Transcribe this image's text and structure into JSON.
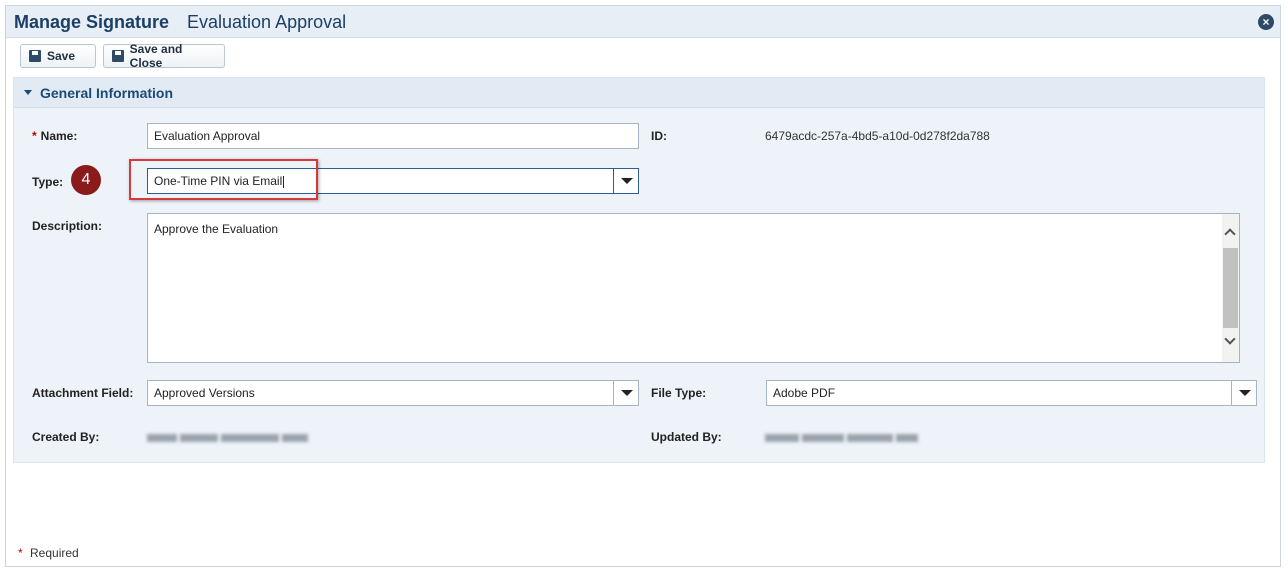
{
  "window": {
    "title": "Manage Signature",
    "subtitle": "Evaluation Approval",
    "close_icon": "close-circle-icon"
  },
  "toolbar": {
    "save_label": "Save",
    "save_close_label": "Save and Close"
  },
  "section": {
    "title": "General Information"
  },
  "form": {
    "required_marker": "*",
    "name_label": "Name:",
    "name_value": "Evaluation Approval",
    "id_label": "ID:",
    "id_value": "6479acdc-257a-4bd5-a10d-0d278f2da788",
    "type_label": "Type:",
    "type_value": "One-Time PIN via Email",
    "description_label": "Description:",
    "description_value": "Approve the Evaluation",
    "attachment_label": "Attachment Field:",
    "attachment_value": "Approved Versions",
    "filetype_label": "File Type:",
    "filetype_value": "Adobe PDF",
    "created_label": "Created By:",
    "updated_label": "Updated By:"
  },
  "annotation": {
    "step_number": "4",
    "highlight_color": "#d9383a",
    "badge_color": "#8b1a1a"
  },
  "footer": {
    "required_marker": "*",
    "required_text": "Required"
  }
}
